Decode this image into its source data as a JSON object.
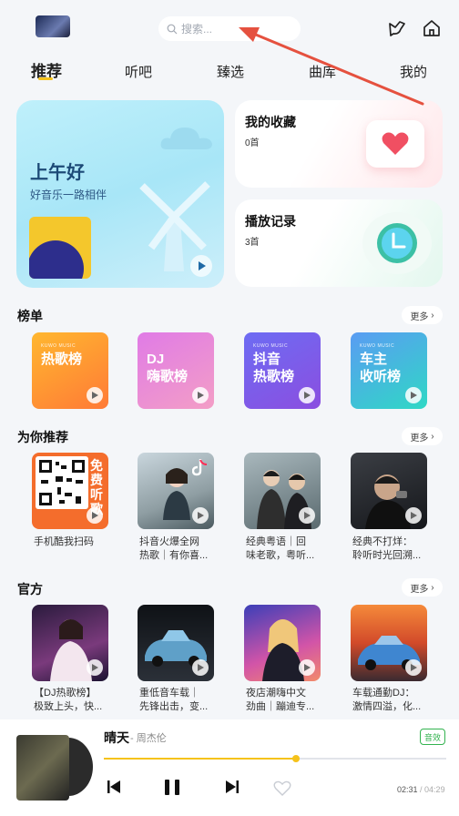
{
  "header": {
    "search_placeholder": "搜索...",
    "icons": [
      "app-logo",
      "search-icon",
      "recognize-icon",
      "home-icon"
    ]
  },
  "tabs": [
    {
      "label": "推荐",
      "active": true
    },
    {
      "label": "听吧",
      "active": false
    },
    {
      "label": "臻选",
      "active": false
    },
    {
      "label": "曲库",
      "active": false
    },
    {
      "label": "我的",
      "active": false
    }
  ],
  "featured": {
    "greeting": "上午好",
    "subtitle": "好音乐一路相伴",
    "favorites": {
      "title": "我的收藏",
      "count": "0首"
    },
    "history": {
      "title": "播放记录",
      "count": "3首"
    }
  },
  "charts_section": {
    "title": "榜单",
    "more": "更多",
    "items": [
      {
        "sub": "KUWO MUSIC",
        "line1": "热歌榜",
        "line2": ""
      },
      {
        "sub": "",
        "line1": "DJ",
        "line2": "嗨歌榜"
      },
      {
        "sub": "KUWO MUSIC",
        "line1": "抖音",
        "line2": "热歌榜"
      },
      {
        "sub": "KUWO MUSIC",
        "line1": "车主",
        "line2": "收听榜"
      }
    ]
  },
  "recommend_section": {
    "title": "为你推荐",
    "more": "更多",
    "items": [
      {
        "caption1": "手机酷我扫码",
        "caption2": "",
        "badge": "免费听歌"
      },
      {
        "caption1": "抖音火爆全网",
        "caption2": "热歌｜有你喜...",
        "badge": ""
      },
      {
        "caption1": "经典粤语｜回",
        "caption2": "味老歌，粤听...",
        "badge": ""
      },
      {
        "caption1": "经典不打烊：",
        "caption2": "聆听时光回溯...",
        "badge": ""
      }
    ]
  },
  "official_section": {
    "title": "官方",
    "more": "更多",
    "items": [
      {
        "caption1": "【DJ热歌榜】",
        "caption2": "极致上头，快..."
      },
      {
        "caption1": "重低音车载｜",
        "caption2": "先锋出击，变..."
      },
      {
        "caption1": "夜店潮嗨中文",
        "caption2": "劲曲｜蹦迪专..."
      },
      {
        "caption1": "车载通勤DJ：",
        "caption2": "激情四溢，化..."
      }
    ]
  },
  "player": {
    "song": "晴天",
    "artist": "- 周杰伦",
    "quality": "音效",
    "elapsed": "02:31",
    "total": "/ 04:29",
    "progress": 0.56
  },
  "colors": {
    "accent": "#f5c21b",
    "quality_green": "#33b34f",
    "annotation_arrow": "#e5513f"
  }
}
